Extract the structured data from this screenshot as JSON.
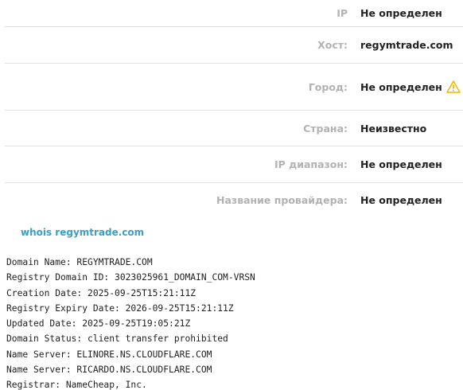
{
  "info": {
    "rows": [
      {
        "label": "IP",
        "value": "Не определен"
      },
      {
        "label": "Хост:",
        "value": "regymtrade.com"
      },
      {
        "label": "Город:",
        "value": "Не определен",
        "icon": "warning-icon"
      },
      {
        "label": "Страна:",
        "value": "Неизвестно"
      },
      {
        "label": "IP диапазон:",
        "value": "Не определен"
      },
      {
        "label": "Название провайдера:",
        "value": "Не определен"
      }
    ]
  },
  "whois": {
    "link_label": "whois regymtrade.com",
    "lines": [
      "Domain Name: REGYMTRADE.COM",
      "Registry Domain ID: 3023025961_DOMAIN_COM-VRSN",
      "Creation Date: 2025-09-25T15:21:11Z",
      "Registry Expiry Date: 2026-09-25T15:21:11Z",
      "Updated Date: 2025-09-25T19:05:21Z",
      "Domain Status: client transfer prohibited",
      "Name Server: ELINORE.NS.CLOUDFLARE.COM",
      "Name Server: RICARDO.NS.CLOUDFLARE.COM",
      "Registrar: NameCheap, Inc."
    ]
  },
  "colors": {
    "label": "#b2b2b2",
    "value": "#222222",
    "link": "#3a9ec9",
    "warning": "#f2b705"
  }
}
